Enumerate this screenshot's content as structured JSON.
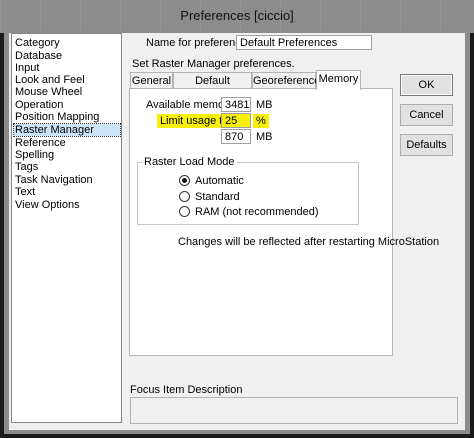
{
  "window": {
    "title": "Preferences [ciccio]"
  },
  "sidebar": {
    "header": "Category",
    "items": [
      {
        "label": "Database"
      },
      {
        "label": "Input"
      },
      {
        "label": "Look and Feel"
      },
      {
        "label": "Mouse Wheel"
      },
      {
        "label": "Operation"
      },
      {
        "label": "Position Mapping"
      },
      {
        "label": "Raster Manager",
        "selected": true
      },
      {
        "label": "Reference"
      },
      {
        "label": "Spelling"
      },
      {
        "label": "Tags"
      },
      {
        "label": "Task Navigation"
      },
      {
        "label": "Text"
      },
      {
        "label": "View Options"
      }
    ]
  },
  "prefs_name": {
    "label": "Name for preferences",
    "value": "Default Preferences"
  },
  "description": "Set Raster Manager preferences.",
  "tabs": [
    {
      "label": "General"
    },
    {
      "label": "Default Attributes"
    },
    {
      "label": "Georeference"
    },
    {
      "label": "Memory",
      "active": true
    }
  ],
  "memory": {
    "available_label": "Available memory:",
    "available_value": "3481",
    "available_unit": "MB",
    "limit_label": "Limit usage to:",
    "limit_value": "25",
    "limit_unit": "%",
    "limit_mb_value": "870",
    "limit_mb_unit": "MB",
    "highlight_color": "#f8f00a"
  },
  "raster_load_mode": {
    "label": "Raster Load Mode",
    "options": [
      {
        "label": "Automatic",
        "checked": true
      },
      {
        "label": "Standard",
        "checked": false
      },
      {
        "label": "RAM (not recommended)",
        "checked": false
      }
    ]
  },
  "restart_note": "Changes will be reflected after restarting MicroStation",
  "buttons": {
    "ok": "OK",
    "cancel": "Cancel",
    "defaults": "Defaults"
  },
  "focus_item": {
    "label": "Focus Item Description",
    "text": ""
  }
}
